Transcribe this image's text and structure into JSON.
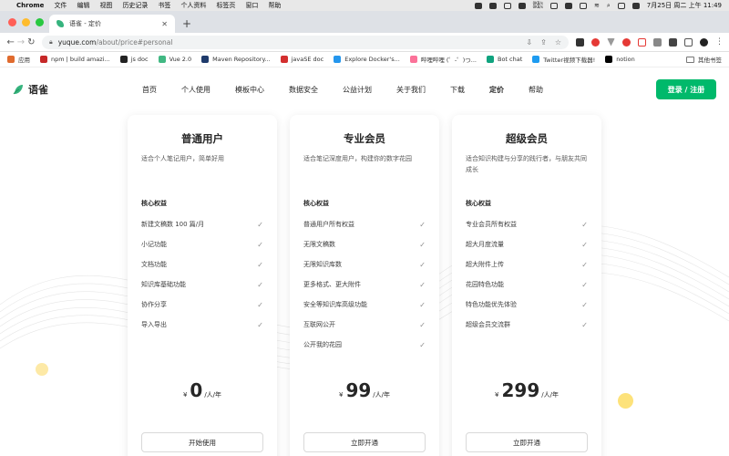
{
  "menubar": {
    "app": "Chrome",
    "items": [
      "文件",
      "编辑",
      "视图",
      "历史记录",
      "书签",
      "个人资料",
      "标签页",
      "窗口",
      "帮助"
    ],
    "net_up": "0KB/s",
    "net_down": "0KB/s",
    "clock": "7月25日 周二 上午 11:49"
  },
  "browser": {
    "tab_title": "语雀 - 定价",
    "url_host": "yuque.com",
    "url_path": "/about/price#personal",
    "bookmarks": [
      {
        "label": "应用",
        "color": "#e06b2e"
      },
      {
        "label": "npm | build amazi...",
        "color": "#c62828"
      },
      {
        "label": "js doc",
        "color": "#222222"
      },
      {
        "label": "Vue 2.0",
        "color": "#41b883"
      },
      {
        "label": "Maven Repository...",
        "color": "#1e3a6b"
      },
      {
        "label": "javaSE doc",
        "color": "#d32f2f"
      },
      {
        "label": "Explore Docker's...",
        "color": "#2496ed"
      },
      {
        "label": "哔哩哔哩 (゜-゜)つ...",
        "color": "#fb7299"
      },
      {
        "label": "Bot chat",
        "color": "#10a37f"
      },
      {
        "label": "Twitter视频下载器!",
        "color": "#1d9bf0"
      },
      {
        "label": "notion",
        "color": "#000000"
      }
    ],
    "other_bookmarks": "其他书签"
  },
  "site": {
    "logo_text": "语雀",
    "nav": [
      "首页",
      "个人使用",
      "模板中心",
      "数据安全",
      "公益计划",
      "关于我们",
      "下载",
      "定价",
      "帮助"
    ],
    "active_nav": "定价",
    "login_label": "登录 / 注册",
    "brand_color": "#00b96b"
  },
  "plans": [
    {
      "name": "普通用户",
      "desc": "适合个人笔记用户，简单好用",
      "section": "核心权益",
      "features": [
        "新建文稿数 100 篇/月",
        "小记功能",
        "文档功能",
        "知识库基础功能",
        "协作分享",
        "导入导出"
      ],
      "currency": "¥",
      "price": "0",
      "unit": "/人/年",
      "cta": "开始使用"
    },
    {
      "name": "专业会员",
      "desc": "适合笔记深度用户，构建你的数字花园",
      "section": "核心权益",
      "features": [
        "普通用户所有权益",
        "无限文稿数",
        "无限知识库数",
        "更多格式、更大附件",
        "安全等知识库高级功能",
        "互联网公开",
        "公开我的花园"
      ],
      "currency": "¥",
      "price": "99",
      "unit": "/人/年",
      "cta": "立即开通"
    },
    {
      "name": "超级会员",
      "desc": "适合知识构建与分享的践行者，与朋友共同成长",
      "section": "核心权益",
      "features": [
        "专业会员所有权益",
        "超大月度流量",
        "超大附件上传",
        "花园特色功能",
        "特色功能优先体验",
        "超级会员交流群"
      ],
      "currency": "¥",
      "price": "299",
      "unit": "/人/年",
      "cta": "立即开通"
    }
  ],
  "check_glyph": "✓"
}
